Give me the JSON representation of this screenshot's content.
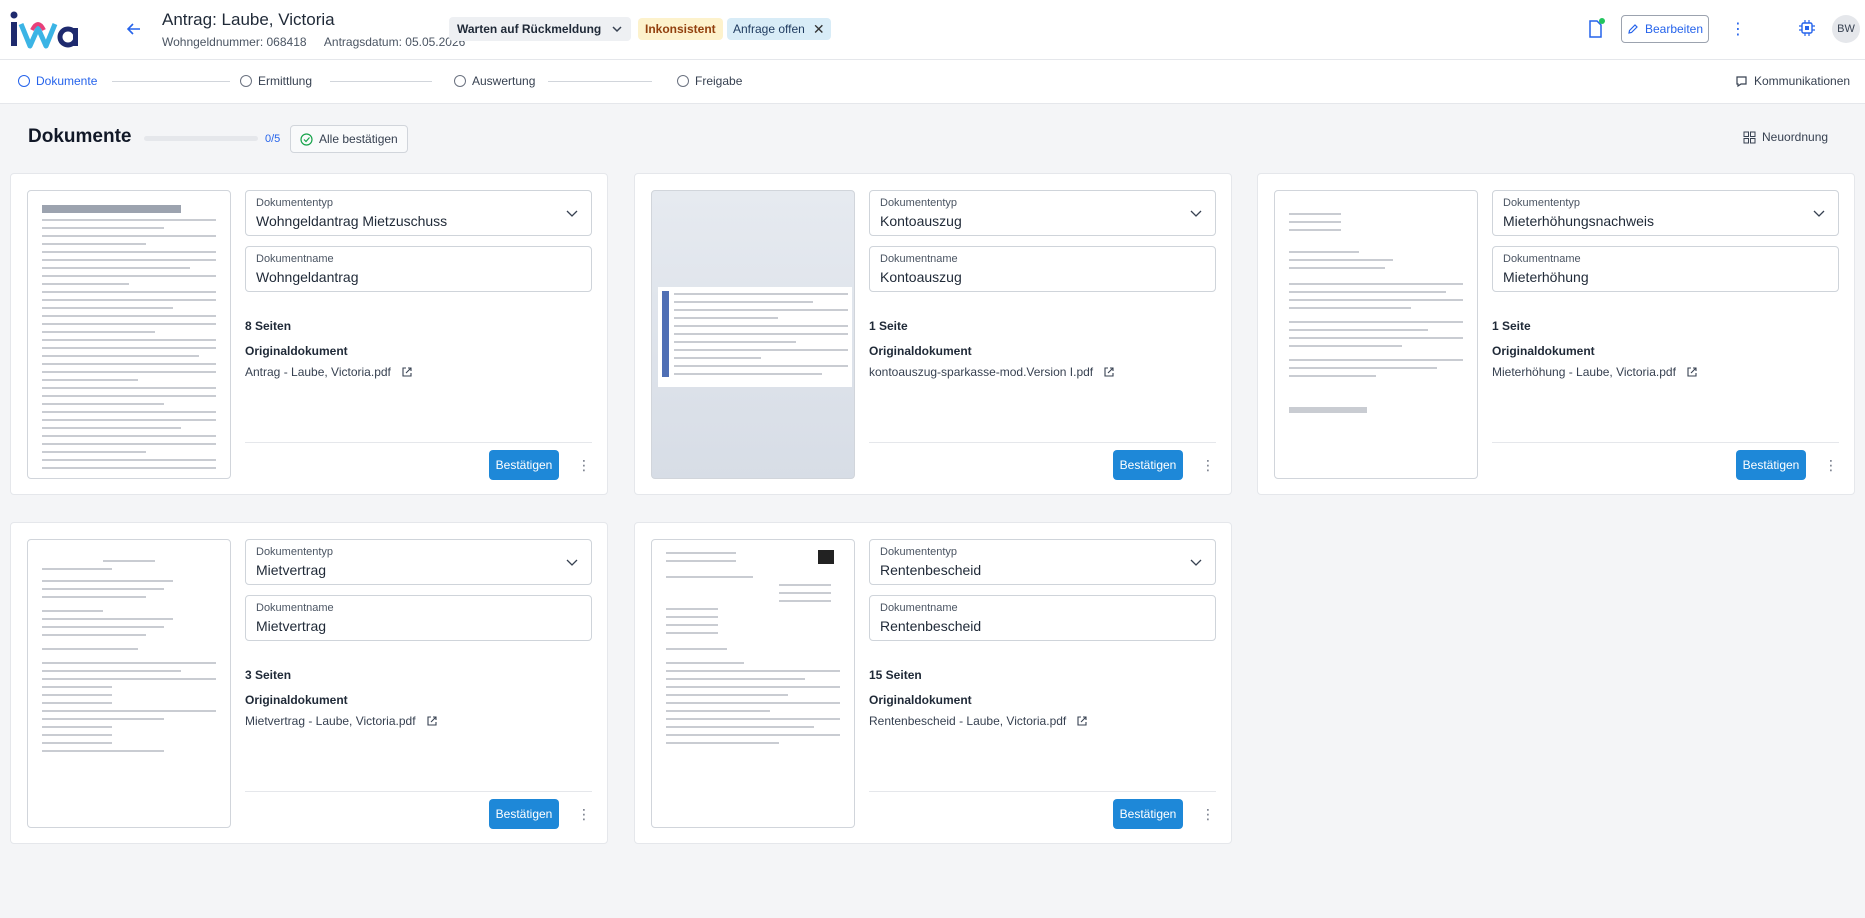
{
  "header": {
    "logo_text": "iwa",
    "title": "Antrag: Laube, Victoria",
    "wohngeldnummer": "Wohngeldnummer: 068418",
    "antragsdatum": "Antragsdatum: 05.05.2026",
    "status": "Warten auf Rückmeldung",
    "badge_inconsistent": "Inkonsistent",
    "badge_request": "Anfrage offen",
    "edit_label": "Bearbeiten",
    "avatar": "BW"
  },
  "stepper": {
    "steps": [
      "Dokumente",
      "Ermittlung",
      "Auswertung",
      "Freigabe"
    ],
    "communications": "Kommunikationen"
  },
  "section": {
    "title": "Dokumente",
    "progress_text": "0/5",
    "progress_fraction": 0,
    "confirm_all": "Alle bestätigen",
    "reorder": "Neuordnung"
  },
  "labels": {
    "doctype": "Dokumententyp",
    "docname": "Dokumentname",
    "original": "Originaldokument",
    "confirm": "Bestätigen"
  },
  "documents": [
    {
      "type": "Wohngeldantrag Mietzuschuss",
      "name": "Wohngeldantrag",
      "pages": "8 Seiten",
      "file": "Antrag - Laube, Victoria.pdf"
    },
    {
      "type": "Kontoauszug",
      "name": "Kontoauszug",
      "pages": "1 Seite",
      "file": "kontoauszug-sparkasse-mod.Version I.pdf"
    },
    {
      "type": "Mieterhöhungsnachweis",
      "name": "Mieterhöhung",
      "pages": "1 Seite",
      "file": "Mieterhöhung - Laube, Victoria.pdf"
    },
    {
      "type": "Mietvertrag",
      "name": "Mietvertrag",
      "pages": "3 Seiten",
      "file": "Mietvertrag - Laube, Victoria.pdf"
    },
    {
      "type": "Rentenbescheid",
      "name": "Rentenbescheid",
      "pages": "15 Seiten",
      "file": "Rentenbescheid - Laube, Victoria.pdf"
    }
  ],
  "colors": {
    "accent": "#2563eb",
    "confirm_button": "#1e88d8",
    "warn_badge": "#fdf2cc",
    "info_badge": "#d8ecf7"
  }
}
